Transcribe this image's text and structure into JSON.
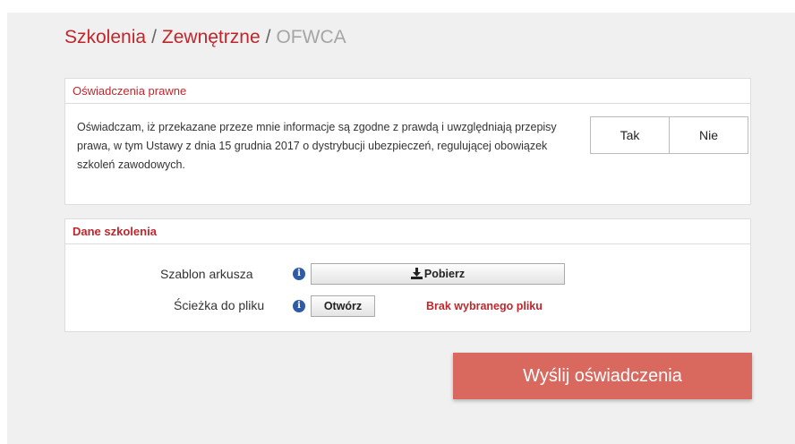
{
  "breadcrumb": {
    "items": [
      "Szkolenia",
      "Zewnętrzne"
    ],
    "separator": "/",
    "current": "OFWCA"
  },
  "legal_panel": {
    "title": "Oświadczenia prawne",
    "text": "Oświadczam, iż przekazane przeze mnie informacje są zgodne z prawdą i uwzględniają przepisy prawa, w tym Ustawy z dnia 15 grudnia 2017 o dystrybucji ubezpieczeń, regulującej obowiązek szkoleń zawodowych.",
    "yes_label": "Tak",
    "no_label": "Nie"
  },
  "training_panel": {
    "title": "Dane szkolenia",
    "template_label": "Szablon arkusza",
    "download_label": "Pobierz",
    "file_path_label": "Ścieżka do pliku",
    "open_label": "Otwórz",
    "no_file_text": "Brak wybranego pliku",
    "info_icon": "i"
  },
  "submit": {
    "label": "Wyślij oświadczenia"
  },
  "colors": {
    "brand_red": "#c0262c",
    "submit_bg": "#d9695f",
    "info_blue": "#2f5aa8",
    "page_bg": "#f0f0f0"
  }
}
